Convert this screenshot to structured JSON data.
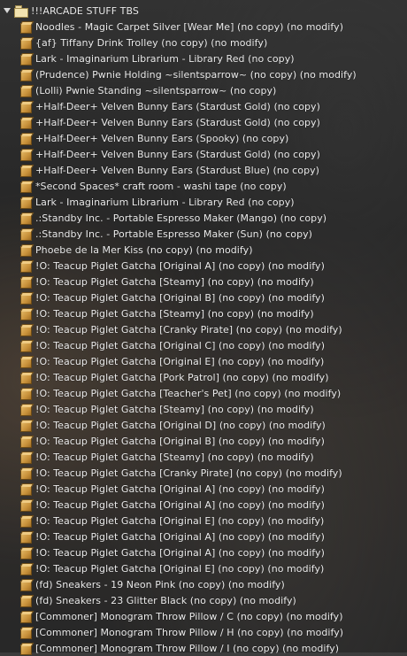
{
  "inventory": {
    "folder": {
      "label": "!!!ARCADE STUFF TBS",
      "expanded": true,
      "icon": "folder-open-icon"
    },
    "item_icon": "object-box-icon",
    "items": [
      "Noodles - Magic Carpet Silver [Wear Me] (no copy) (no modify)",
      "{af} Tiffany Drink Trolley (no copy) (no modify)",
      "Lark - Imaginarium Librarium - Library Red (no copy)",
      "(Prudence) Pwnie Holding ~silentsparrow~ (no copy) (no modify)",
      "(Lolli) Pwnie Standing ~silentsparrow~ (no copy)",
      "+Half-Deer+ Velven Bunny Ears (Stardust Gold) (no copy)",
      "+Half-Deer+ Velven Bunny Ears (Stardust Gold) (no copy)",
      "+Half-Deer+ Velven Bunny Ears (Spooky) (no copy)",
      "+Half-Deer+ Velven Bunny Ears (Stardust Gold) (no copy)",
      "+Half-Deer+ Velven Bunny Ears (Stardust Blue) (no copy)",
      "*Second Spaces* craft room - washi tape (no copy)",
      "Lark - Imaginarium Librarium - Library Red (no copy)",
      ".:Standby Inc. - Portable Espresso Maker (Mango) (no copy)",
      ".:Standby Inc. - Portable Espresso Maker (Sun) (no copy)",
      "Phoebe de la Mer Kiss (no copy) (no modify)",
      "!O: Teacup Piglet Gatcha [Original A] (no copy) (no modify)",
      "!O: Teacup Piglet Gatcha [Steamy] (no copy) (no modify)",
      "!O: Teacup Piglet Gatcha [Original B] (no copy) (no modify)",
      "!O: Teacup Piglet Gatcha [Steamy] (no copy) (no modify)",
      "!O: Teacup Piglet Gatcha [Cranky Pirate] (no copy) (no modify)",
      "!O: Teacup Piglet Gatcha [Original C] (no copy) (no modify)",
      "!O: Teacup Piglet Gatcha [Original E] (no copy) (no modify)",
      "!O: Teacup Piglet Gatcha [Pork Patrol] (no copy) (no modify)",
      "!O: Teacup Piglet Gatcha [Teacher's Pet] (no copy) (no modify)",
      "!O: Teacup Piglet Gatcha [Steamy] (no copy) (no modify)",
      "!O: Teacup Piglet Gatcha [Original D] (no copy) (no modify)",
      "!O: Teacup Piglet Gatcha [Original B] (no copy) (no modify)",
      "!O: Teacup Piglet Gatcha [Steamy] (no copy) (no modify)",
      "!O: Teacup Piglet Gatcha [Cranky Pirate] (no copy) (no modify)",
      "!O: Teacup Piglet Gatcha [Original A] (no copy) (no modify)",
      "!O: Teacup Piglet Gatcha [Original A] (no copy) (no modify)",
      "!O: Teacup Piglet Gatcha [Original E] (no copy) (no modify)",
      "!O: Teacup Piglet Gatcha [Original A] (no copy) (no modify)",
      "!O: Teacup Piglet Gatcha [Original A] (no copy) (no modify)",
      "!O: Teacup Piglet Gatcha [Original E] (no copy) (no modify)",
      "(fd) Sneakers - 19 Neon Pink (no copy) (no modify)",
      "(fd) Sneakers - 23 Glitter Black (no copy) (no modify)",
      "[Commoner] Monogram Throw Pillow / C (no copy) (no modify)",
      "[Commoner] Monogram Throw Pillow / H (no copy) (no modify)",
      "[Commoner] Monogram Throw Pillow / I (no copy) (no modify)"
    ]
  }
}
